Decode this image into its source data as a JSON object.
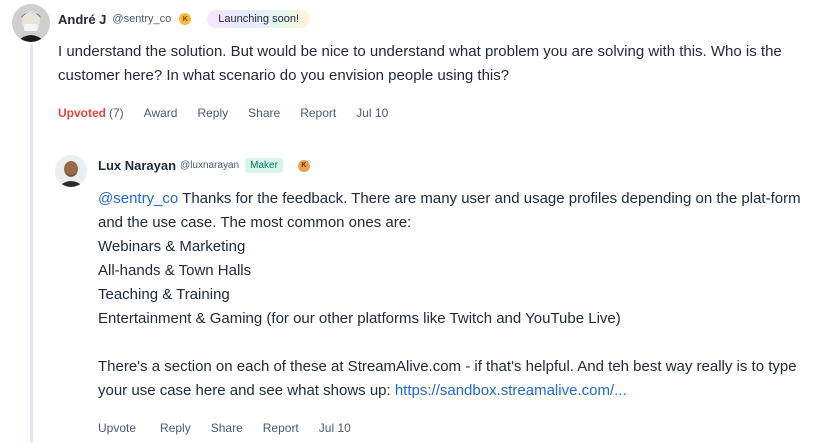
{
  "comment": {
    "author_name": "André J",
    "author_handle": "@sentry_co",
    "karma_letter": "K",
    "badge": "Launching soon!",
    "body": "I understand the solution. But would be nice to understand what problem you are solving with this. Who is the customer here? In what scenario do you envision people using this?",
    "actions": {
      "upvote_label": "Upvoted",
      "upvote_count": "(7)",
      "award": "Award",
      "reply": "Reply",
      "share": "Share",
      "report": "Report",
      "date": "Jul 10"
    }
  },
  "reply": {
    "author_name": "Lux Narayan",
    "author_handle": "@luxnarayan",
    "badge": "Maker",
    "karma_letter": "K",
    "mention": "@sentry_co",
    "first_text": " Thanks for the feedback. There are many user and usage profiles depending on the plat-form and the use case. The most common ones are:",
    "profiles": [
      "Webinars & Marketing",
      "All-hands & Town Halls",
      "Teaching & Training",
      "Entertainment & Gaming (for our other platforms like Twitch and YouTube Live)"
    ],
    "second_text": "There's a section on each of these at StreamAlive.com - if that's helpful. And teh best way really is to type your use case here and see what shows up: ",
    "link": "https://sandbox.streamalive.com/...",
    "actions": {
      "upvote": "Upvote",
      "reply": "Reply",
      "share": "Share",
      "report": "Report",
      "date": "Jul 10"
    }
  }
}
